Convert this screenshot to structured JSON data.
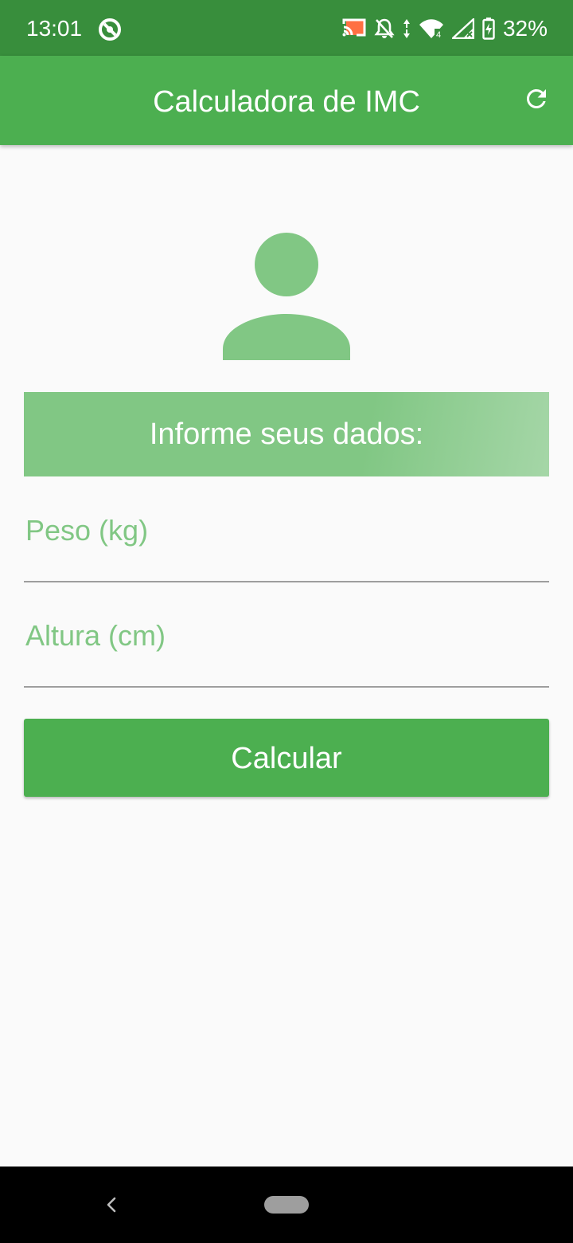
{
  "status_bar": {
    "time": "13:01",
    "battery_percent": "32%",
    "icons": [
      "vpn-icon",
      "cast-icon",
      "mute-icon",
      "data-arrows-icon",
      "wifi-icon",
      "signal-icon",
      "battery-icon"
    ]
  },
  "app_bar": {
    "title": "Calculadora de IMC",
    "action_icon": "refresh-icon"
  },
  "hero": {
    "icon": "person-icon"
  },
  "banner": {
    "text": "Informe seus dados:"
  },
  "form": {
    "weight_label": "Peso (kg)",
    "height_label": "Altura (cm)",
    "weight_value": "",
    "height_value": "",
    "submit_label": "Calcular"
  },
  "nav_bar": {
    "icons": [
      "back-icon",
      "home-pill-icon"
    ]
  },
  "colors": {
    "status_bar": "#388e3c",
    "primary": "#4caf50",
    "primary_light": "#81c784",
    "background": "#fafafa",
    "underline": "#9e9e9e",
    "nav_bar": "#000000"
  }
}
